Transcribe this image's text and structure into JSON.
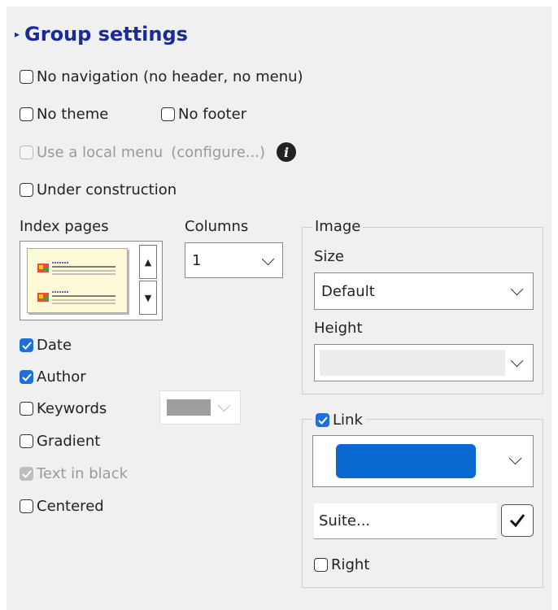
{
  "header": {
    "title": "Group settings"
  },
  "options": {
    "no_navigation": "No navigation (no header, no menu)",
    "no_theme": "No theme",
    "no_footer": "No footer",
    "local_menu": "Use a local menu",
    "configure": "(configure...)",
    "under_construction": "Under construction"
  },
  "index": {
    "label": "Index pages",
    "columns_label": "Columns",
    "columns_value": "1"
  },
  "display": {
    "date": "Date",
    "author": "Author",
    "keywords": "Keywords",
    "gradient": "Gradient",
    "text_in_black": "Text in black",
    "centered": "Centered"
  },
  "image": {
    "legend": "Image",
    "size_label": "Size",
    "size_value": "Default",
    "height_label": "Height",
    "height_value": ""
  },
  "link": {
    "legend": "Link",
    "color": "#0a68d1",
    "text_value": "Suite...",
    "right_label": "Right"
  },
  "colors": {
    "keywords_swatch": "#9e9e9e",
    "accent": "#1e6fd9",
    "title": "#1a2a9a"
  }
}
